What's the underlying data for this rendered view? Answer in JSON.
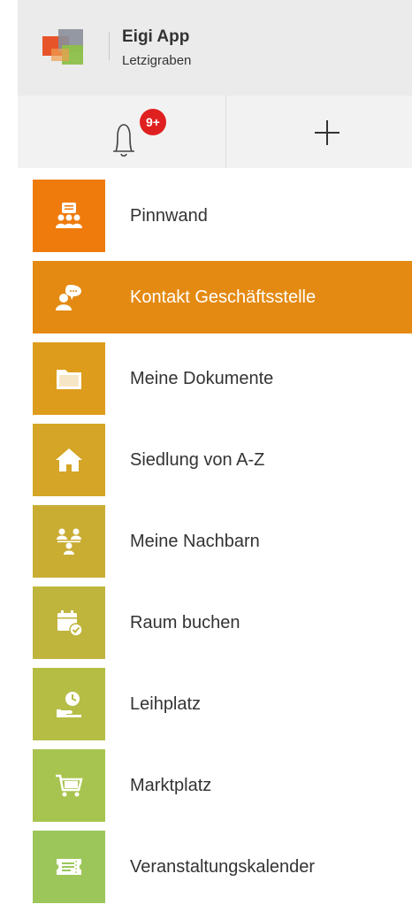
{
  "header": {
    "app_name": "Eigi App",
    "subtitle": "Letzigraben"
  },
  "toolbar": {
    "notification_badge": "9+",
    "bell_icon": "bell-icon",
    "add_icon": "plus-icon"
  },
  "menu": {
    "items": [
      {
        "label": "Pinnwand",
        "icon": "bulletin-board-icon",
        "color": "#ee7b0c"
      },
      {
        "label": "Kontakt Geschäftsstelle",
        "icon": "contact-chat-icon",
        "color": "#e48a12",
        "active": true
      },
      {
        "label": "Meine Dokumente",
        "icon": "folder-icon",
        "color": "#de9c1c"
      },
      {
        "label": "Siedlung von A-Z",
        "icon": "home-icon",
        "color": "#d4a526"
      },
      {
        "label": "Meine Nachbarn",
        "icon": "neighbors-icon",
        "color": "#c9ad33"
      },
      {
        "label": "Raum buchen",
        "icon": "calendar-check-icon",
        "color": "#bfb53d"
      },
      {
        "label": "Leihplatz",
        "icon": "lending-clock-icon",
        "color": "#b5bd45"
      },
      {
        "label": "Marktplatz",
        "icon": "shopping-cart-icon",
        "color": "#a8c450"
      },
      {
        "label": "Veranstaltungskalender",
        "icon": "ticket-icon",
        "color": "#9cc65a"
      }
    ]
  }
}
